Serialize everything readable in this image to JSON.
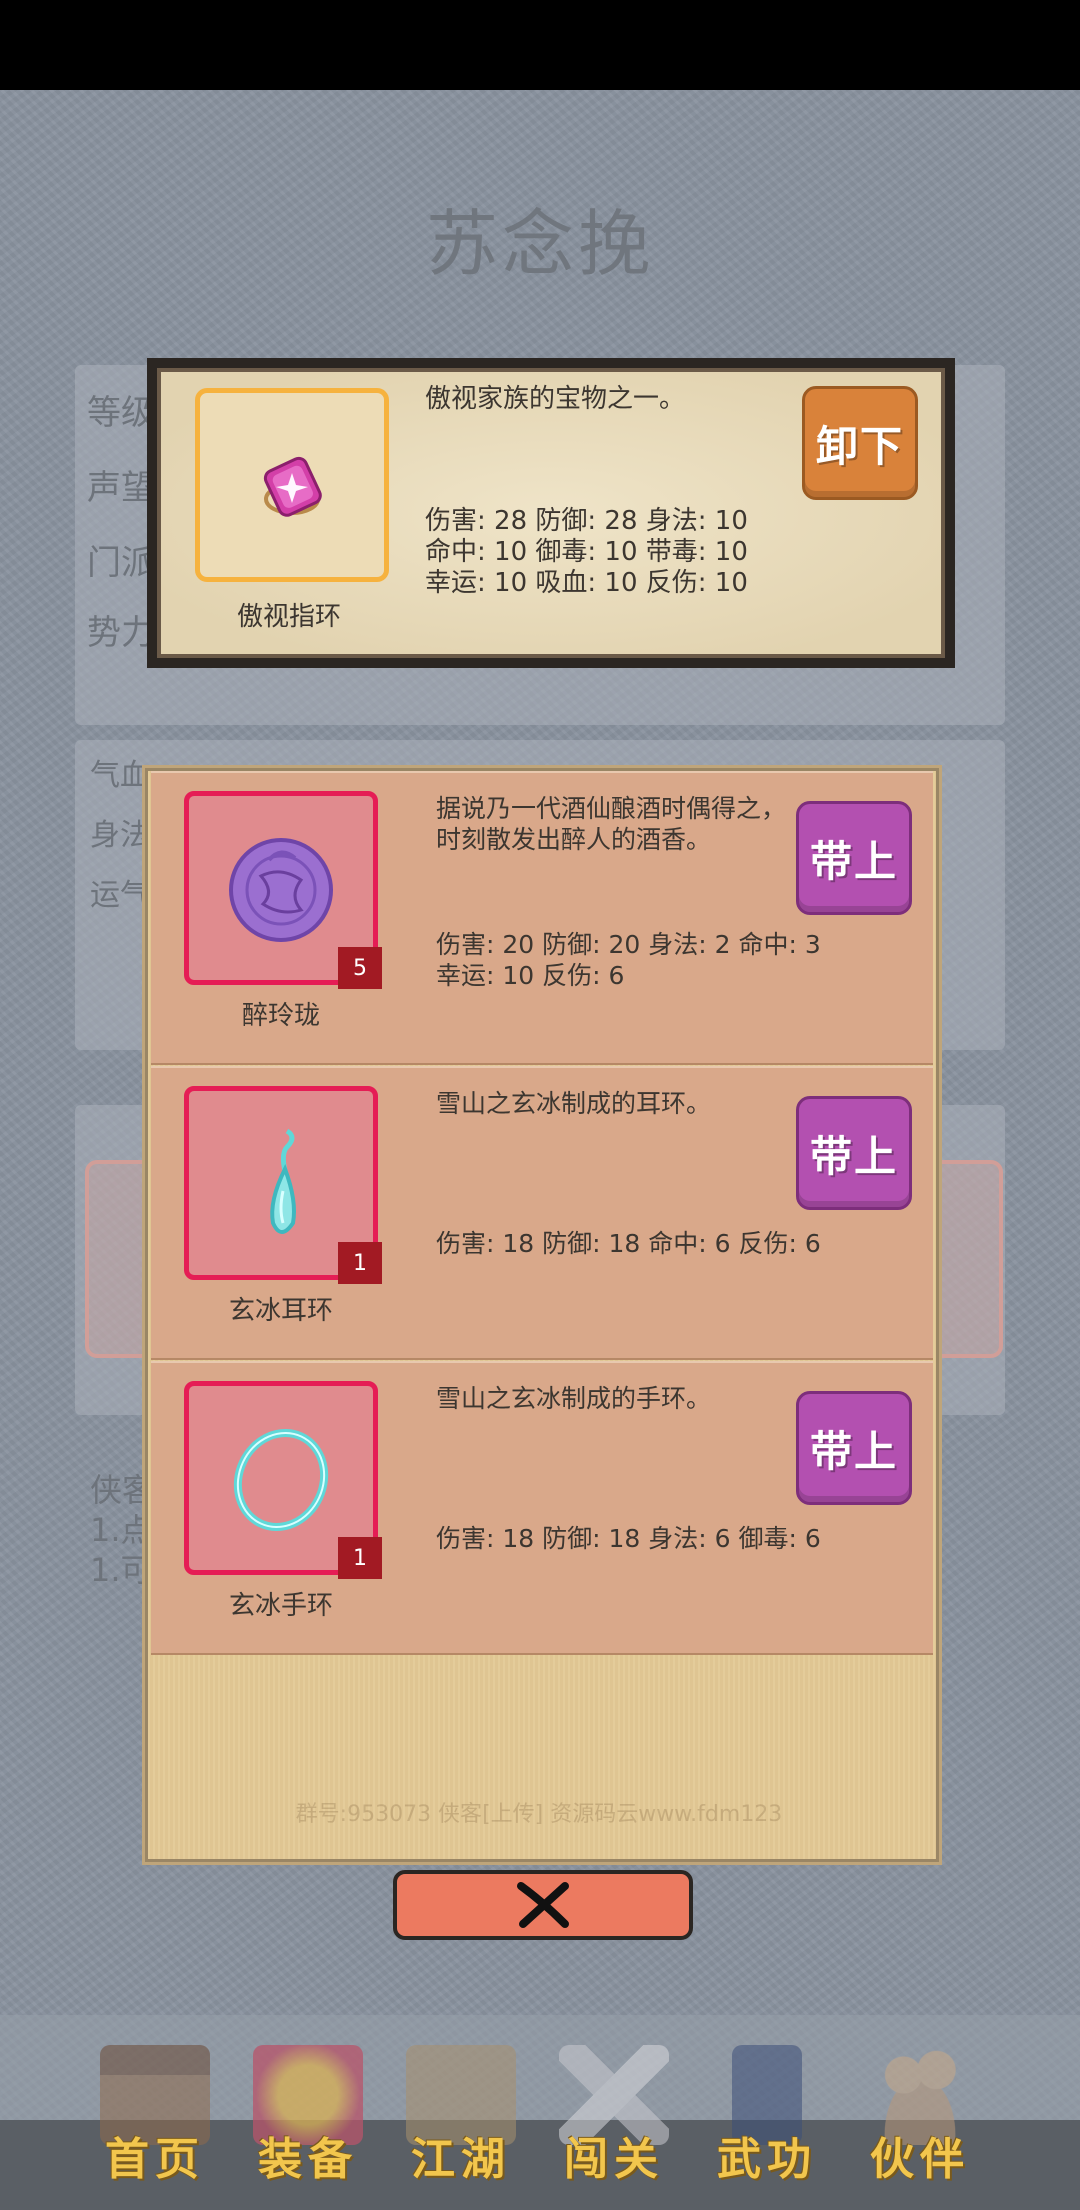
{
  "hero": {
    "name": "苏念挽",
    "info": [
      "等级",
      "声望",
      "门派",
      "势力：皇族"
    ],
    "stats": [
      "气血",
      "身法",
      "运气"
    ],
    "notes": [
      "侠客",
      "1.点",
      "1.可"
    ]
  },
  "equipped": {
    "name": "傲视指环",
    "description": "傲视家族的宝物之一。",
    "stats": [
      "伤害: 28 防御: 28 身法: 10",
      "命中: 10 御毒: 10 带毒: 10",
      "幸运: 10 吸血: 10 反伤: 10"
    ],
    "action_label": "卸下",
    "icon": "pink-ring-icon"
  },
  "inventory": [
    {
      "name": "醉玲珑",
      "count": "5",
      "description": "据说乃一代酒仙酿酒时偶得之，时刻散发出醉人的酒香。",
      "stats": [
        "伤害: 20 防御: 20 身法: 2 命中: 3",
        "幸运: 10 反伤: 6"
      ],
      "action_label": "带上",
      "icon": "purple-pendant-icon"
    },
    {
      "name": "玄冰耳环",
      "count": "1",
      "description": "雪山之玄冰制成的耳环。",
      "stats": [
        "伤害: 18 防御: 18 命中: 6 反伤: 6"
      ],
      "action_label": "带上",
      "icon": "ice-earring-icon"
    },
    {
      "name": "玄冰手环",
      "count": "1",
      "description": "雪山之玄冰制成的手环。",
      "stats": [
        "伤害: 18 防御: 18 身法: 6 御毒: 6"
      ],
      "action_label": "带上",
      "icon": "ice-bracelet-icon"
    }
  ],
  "watermark": "群号:953073    侠客[上传] 资源码云www.fdm123",
  "close_icon": "close-x-icon",
  "nav": [
    {
      "label": "首页",
      "icon": "house-icon"
    },
    {
      "label": "装备",
      "icon": "armor-icon"
    },
    {
      "label": "江湖",
      "icon": "scroll-map-icon"
    },
    {
      "label": "闯关",
      "icon": "crossed-swords-icon"
    },
    {
      "label": "武功",
      "icon": "book-icon"
    },
    {
      "label": "伙伴",
      "icon": "companions-icon"
    }
  ],
  "colors": {
    "equip_button": "#b350b0",
    "unequip_button": "#d9823a",
    "slot_border_inventory": "#e51d55",
    "slot_border_equipped": "#f6b23e",
    "nav_label": "#f2c64d"
  }
}
